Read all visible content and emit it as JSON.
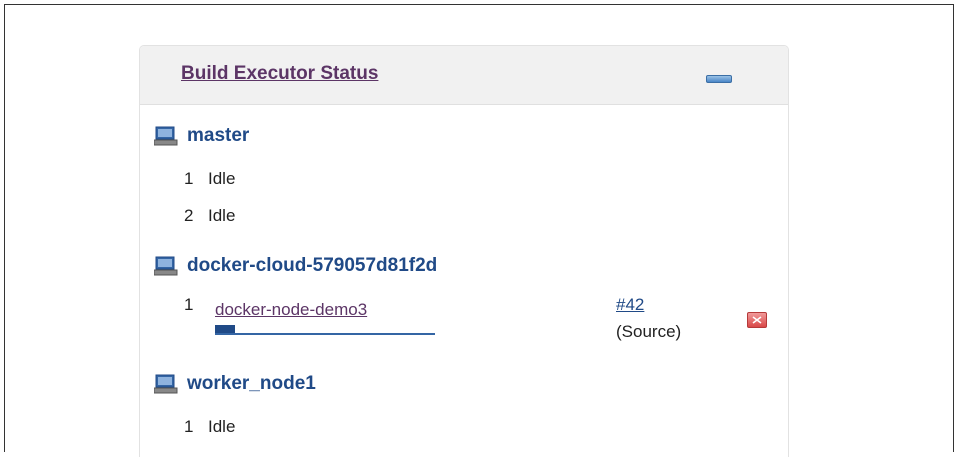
{
  "panel": {
    "title": "Build Executor Status",
    "collapse_icon": "minus-icon"
  },
  "nodes": [
    {
      "name": "master",
      "icon": "computer-icon",
      "executors": [
        {
          "num": "1",
          "status": "Idle"
        },
        {
          "num": "2",
          "status": "Idle"
        }
      ]
    },
    {
      "name": "docker-cloud-579057d81f2d",
      "icon": "computer-icon",
      "executors": [
        {
          "num": "1",
          "job": "docker-node-demo3",
          "build_number": "#42",
          "build_label": "(Source)",
          "progress": 0.09,
          "stop_icon": "stop-icon"
        }
      ]
    },
    {
      "name": "worker_node1",
      "icon": "computer-icon",
      "executors": [
        {
          "num": "1",
          "status": "Idle"
        }
      ]
    }
  ],
  "colors": {
    "link": "#204a87",
    "visited_link": "#5c3566",
    "header_bg": "#f1f1f1",
    "stop": "#d94848"
  }
}
